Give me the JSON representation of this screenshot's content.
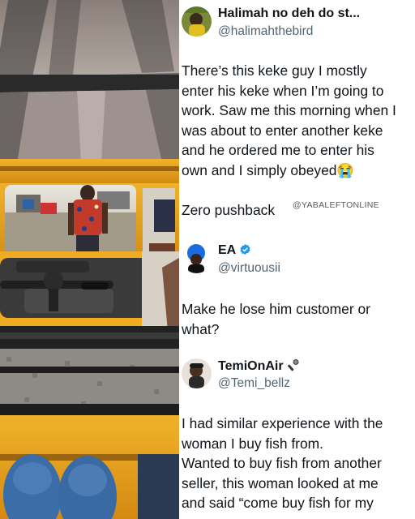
{
  "posts": [
    {
      "name": "Halimah no deh do st...",
      "handle": "@halimahthebird",
      "lines": [
        "There’s this keke guy I mostly",
        "enter his keke when I’m going to",
        "work. Saw me this morning when I",
        "was about to enter another keke",
        "and he ordered me to enter his",
        "own and I simply obeyed😭",
        "",
        "Zero pushback"
      ]
    },
    {
      "name": "EA",
      "handle": "@virtuousii",
      "lines": [
        "Make he lose him customer or",
        "what?"
      ]
    },
    {
      "name": "TemiOnAir",
      "handle": "@Temi_bellz",
      "lines": [
        "I had similar experience with the",
        "woman I buy fish from.",
        "Wanted to buy fish from another",
        "seller, this woman looked at me",
        "and said “come buy fish for my"
      ]
    }
  ],
  "watermark": "@YABALEFTONLINE",
  "colors": {
    "verified": "#1d9bf0",
    "handle": "#536471",
    "keke_yellow": "#e8a21b"
  },
  "icons": {
    "verified": "verified-badge-icon",
    "mic": "microphone-icon"
  }
}
